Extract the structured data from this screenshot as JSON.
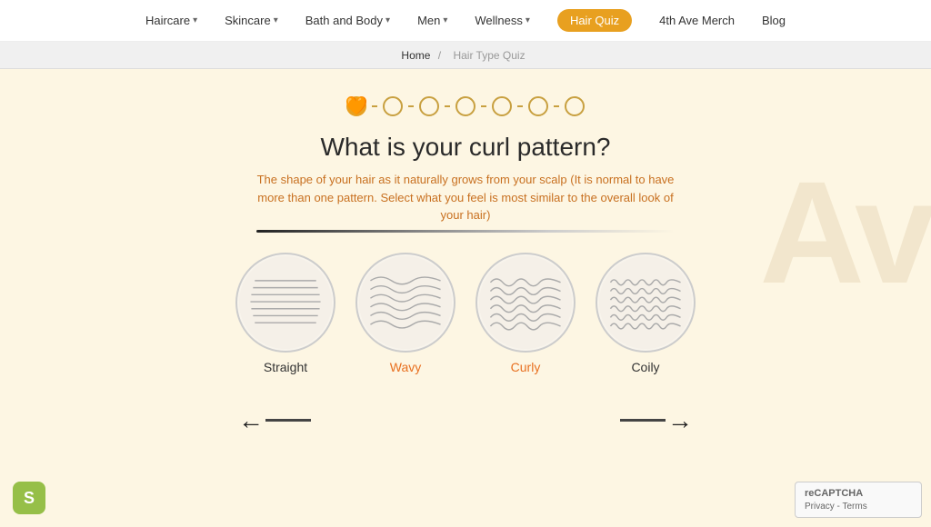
{
  "nav": {
    "items": [
      {
        "label": "Haircare",
        "hasDropdown": true
      },
      {
        "label": "Skincare",
        "hasDropdown": true
      },
      {
        "label": "Bath and Body",
        "hasDropdown": true
      },
      {
        "label": "Men",
        "hasDropdown": true
      },
      {
        "label": "Wellness",
        "hasDropdown": true
      },
      {
        "label": "Hair Quiz",
        "active": true
      },
      {
        "label": "4th Ave Merch",
        "hasDropdown": false
      },
      {
        "label": "Blog",
        "hasDropdown": false
      }
    ]
  },
  "breadcrumb": {
    "home": "Home",
    "separator": "/",
    "current": "Hair Type Quiz"
  },
  "quiz": {
    "title": "What is your curl pattern?",
    "subtitle": "The shape of your hair as it naturally grows from your scalp (It is normal to have more than one pattern. Select what you feel is most similar to the overall look of your hair)",
    "options": [
      {
        "id": "straight",
        "label": "Straight",
        "color": "default"
      },
      {
        "id": "wavy",
        "label": "Wavy",
        "color": "orange"
      },
      {
        "id": "curly",
        "label": "Curly",
        "color": "orange"
      },
      {
        "id": "coily",
        "label": "Coily",
        "color": "default"
      }
    ],
    "back_arrow": "←",
    "next_arrow": "→"
  },
  "progress": {
    "total": 7,
    "current": 1
  },
  "watermark": "Av",
  "shopify": {
    "label": "S"
  },
  "recaptcha": {
    "title": "reCAPTCHA",
    "links": "Privacy - Terms"
  }
}
